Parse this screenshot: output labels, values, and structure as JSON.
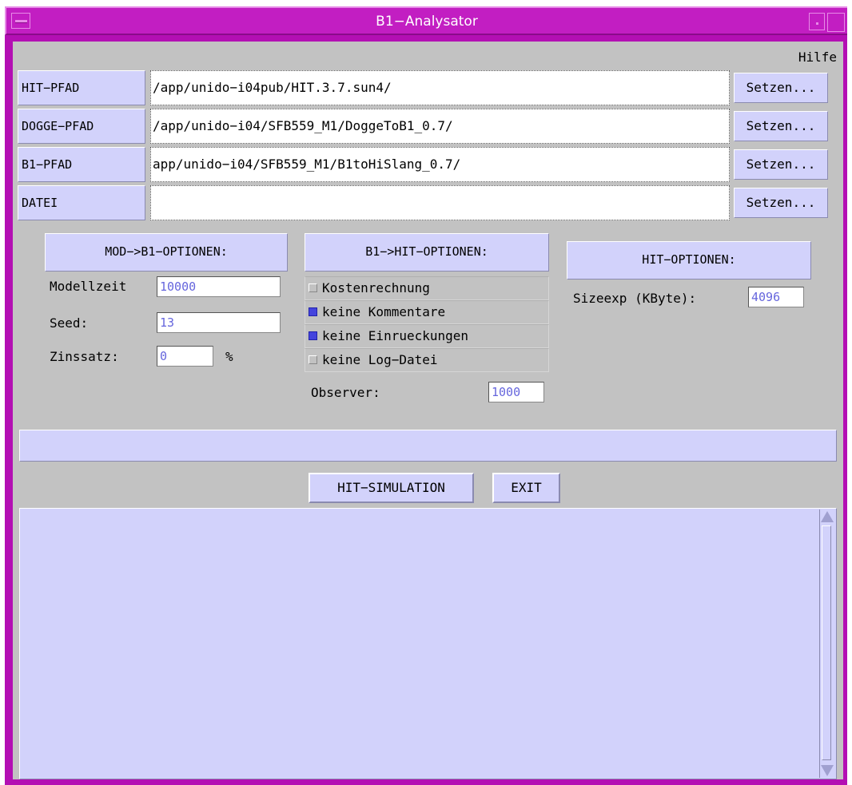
{
  "window": {
    "title": "B1−Analysator"
  },
  "menu": {
    "help": "Hilfe"
  },
  "paths": [
    {
      "label": "HIT−PFAD",
      "value": "/app/unido−i04pub/HIT.3.7.sun4/",
      "button": "Setzen..."
    },
    {
      "label": "DOGGE−PFAD",
      "value": "/app/unido−i04/SFB559_M1/DoggeToB1_0.7/",
      "button": "Setzen..."
    },
    {
      "label": "B1−PFAD",
      "value": "app/unido−i04/SFB559_M1/B1toHiSlang_0.7/",
      "button": "Setzen..."
    },
    {
      "label": "DATEI",
      "value": "",
      "button": "Setzen..."
    }
  ],
  "mod_b1": {
    "title": "MOD−>B1−OPTIONEN:",
    "modellzeit_label": "Modellzeit",
    "modellzeit_value": "10000",
    "seed_label": "Seed:",
    "seed_value": "13",
    "zinssatz_label": "Zinssatz:",
    "zinssatz_value": "0",
    "zinssatz_unit": "%"
  },
  "b1_hit": {
    "title": "B1−>HIT−OPTIONEN:",
    "checks": [
      {
        "label": "Kostenrechnung",
        "checked": false
      },
      {
        "label": "keine Kommentare",
        "checked": true
      },
      {
        "label": "keine Einrueckungen",
        "checked": true
      },
      {
        "label": "keine Log−Datei",
        "checked": false
      }
    ],
    "observer_label": "Observer:",
    "observer_value": "1000"
  },
  "hit": {
    "title": "HIT−OPTIONEN:",
    "sizeexp_label": "Sizeexp (KByte):",
    "sizeexp_value": "4096"
  },
  "actions": {
    "simulate": "HIT−SIMULATION",
    "exit": "EXIT"
  },
  "colors": {
    "titlebar": "#c21ec2",
    "panel": "#c2c2c2",
    "widget": "#d2d2fb",
    "checked": "#4444dd",
    "value_text": "#6666dd"
  }
}
